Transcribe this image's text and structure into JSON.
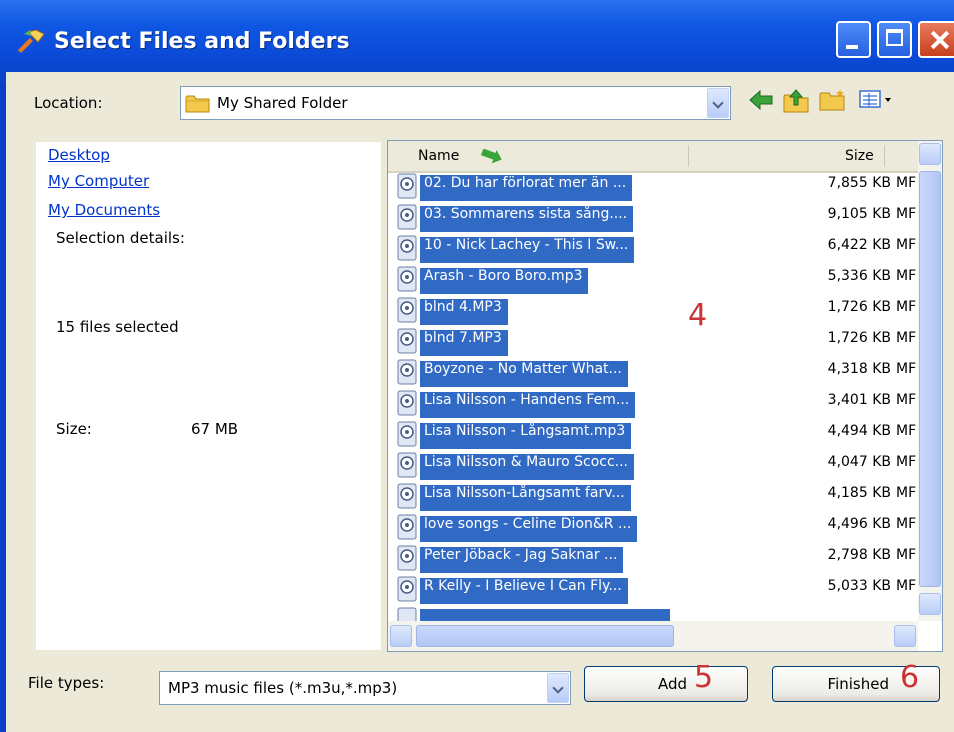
{
  "window": {
    "title": "Select Files and Folders"
  },
  "location": {
    "label": "Location:",
    "value": "My Shared Folder"
  },
  "left_pane": {
    "links": [
      "Desktop",
      "My Computer",
      "My Documents"
    ],
    "details_heading": "Selection details:",
    "files_selected": "15 files selected",
    "size_label": "Size:",
    "size_value": "67 MB"
  },
  "file_list": {
    "columns": {
      "name": "Name",
      "size": "Size"
    },
    "rows": [
      {
        "name": "02. Du har förlorat mer än ...",
        "size": "7,855 KB",
        "type": "MF"
      },
      {
        "name": "03. Sommarens sista sång....",
        "size": "9,105 KB",
        "type": "MF"
      },
      {
        "name": "10 - Nick Lachey - This I Sw...",
        "size": "6,422 KB",
        "type": "MF"
      },
      {
        "name": "Arash - Boro Boro.mp3",
        "size": "5,336 KB",
        "type": "MF"
      },
      {
        "name": "blnd 4.MP3",
        "size": "1,726 KB",
        "type": "MF"
      },
      {
        "name": "blnd 7.MP3",
        "size": "1,726 KB",
        "type": "MF"
      },
      {
        "name": "Boyzone - No Matter What...",
        "size": "4,318 KB",
        "type": "MF"
      },
      {
        "name": "Lisa Nilsson - Handens Fem...",
        "size": "3,401 KB",
        "type": "MF"
      },
      {
        "name": "Lisa Nilsson - Långsamt.mp3",
        "size": "4,494 KB",
        "type": "MF"
      },
      {
        "name": "Lisa Nilsson & Mauro Scocc...",
        "size": "4,047 KB",
        "type": "MF"
      },
      {
        "name": "Lisa Nilsson-Långsamt farv...",
        "size": "4,185 KB",
        "type": "MF"
      },
      {
        "name": "love songs - Celine Dion&R ...",
        "size": "4,496 KB",
        "type": "MF"
      },
      {
        "name": "Peter Jöback - Jag Saknar ...",
        "size": "2,798 KB",
        "type": "MF"
      },
      {
        "name": "R Kelly - I Believe I Can Fly...",
        "size": "5,033 KB",
        "type": "MF"
      }
    ]
  },
  "annotations": {
    "step4": "4",
    "step5": "5",
    "step6": "6"
  },
  "bottom": {
    "file_types_label": "File types:",
    "file_types_value": "MP3 music files (*.m3u,*.mp3)",
    "add_label": "Add",
    "finished_label": "Finished"
  },
  "colors": {
    "selection": "#316ac5",
    "titlebar": "#0a49d6",
    "annotation": "#cc3333"
  },
  "icons": [
    "app-icon",
    "folder-icon",
    "back-arrow-icon",
    "up-folder-icon",
    "new-folder-icon",
    "view-menu-icon",
    "sort-arrow-icon",
    "music-file-icon"
  ]
}
